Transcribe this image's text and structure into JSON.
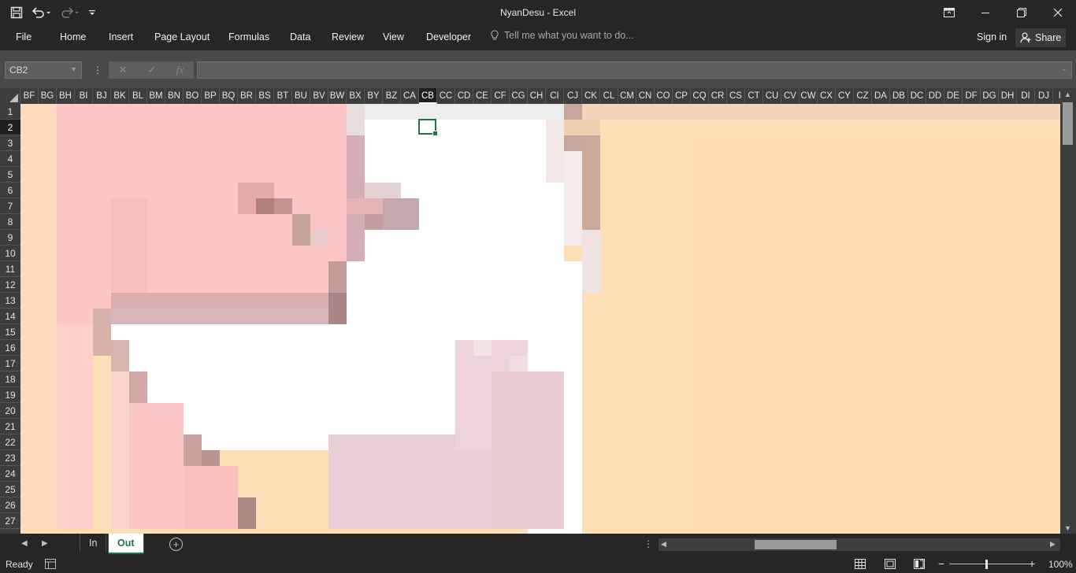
{
  "window": {
    "title": "NyanDesu - Excel"
  },
  "qat": {
    "save_icon": "save-icon",
    "undo_icon": "undo-icon",
    "redo_icon": "redo-icon",
    "customize_icon": "customize-qat-icon"
  },
  "ribbon": {
    "tabs": [
      "File",
      "Home",
      "Insert",
      "Page Layout",
      "Formulas",
      "Data",
      "Review",
      "View",
      "Developer"
    ],
    "tell_me": "Tell me what you want to do...",
    "sign_in": "Sign in",
    "share": "Share"
  },
  "formula_bar": {
    "name_box": "CB2",
    "fx": "fx",
    "cancel": "✕",
    "enter": "✓",
    "value": ""
  },
  "columns": [
    "BF",
    "BG",
    "BH",
    "BI",
    "BJ",
    "BK",
    "BL",
    "BM",
    "BN",
    "BO",
    "BP",
    "BQ",
    "BR",
    "BS",
    "BT",
    "BU",
    "BV",
    "BW",
    "BX",
    "BY",
    "BZ",
    "CA",
    "CB",
    "CC",
    "CD",
    "CE",
    "CF",
    "CG",
    "CH",
    "CI",
    "CJ",
    "CK",
    "CL",
    "CM",
    "CN",
    "CO",
    "CP",
    "CQ",
    "CR",
    "CS",
    "CT",
    "CU",
    "CV",
    "CW",
    "CX",
    "CY",
    "CZ",
    "DA",
    "DB",
    "DC",
    "DD",
    "DE",
    "DF",
    "DG",
    "DH",
    "DI",
    "DJ",
    "D"
  ],
  "rows": [
    "1",
    "2",
    "3",
    "4",
    "5",
    "6",
    "7",
    "8",
    "9",
    "10",
    "11",
    "12",
    "13",
    "14",
    "15",
    "16",
    "17",
    "18",
    "19",
    "20",
    "21",
    "22",
    "23",
    "24",
    "25",
    "26",
    "27"
  ],
  "selected_cell": {
    "column": "CB",
    "row": "2"
  },
  "sheets": {
    "tabs": [
      "In",
      "Out"
    ],
    "active": "Out"
  },
  "status": {
    "ready": "Ready",
    "zoom": "100%"
  },
  "colors": {
    "accent": "#217346",
    "peach": "#ffdfb8",
    "pink": "#fcc6c6",
    "white": "#ffffff",
    "rose": "#c49a9a",
    "lavender": "#ead0d6"
  }
}
